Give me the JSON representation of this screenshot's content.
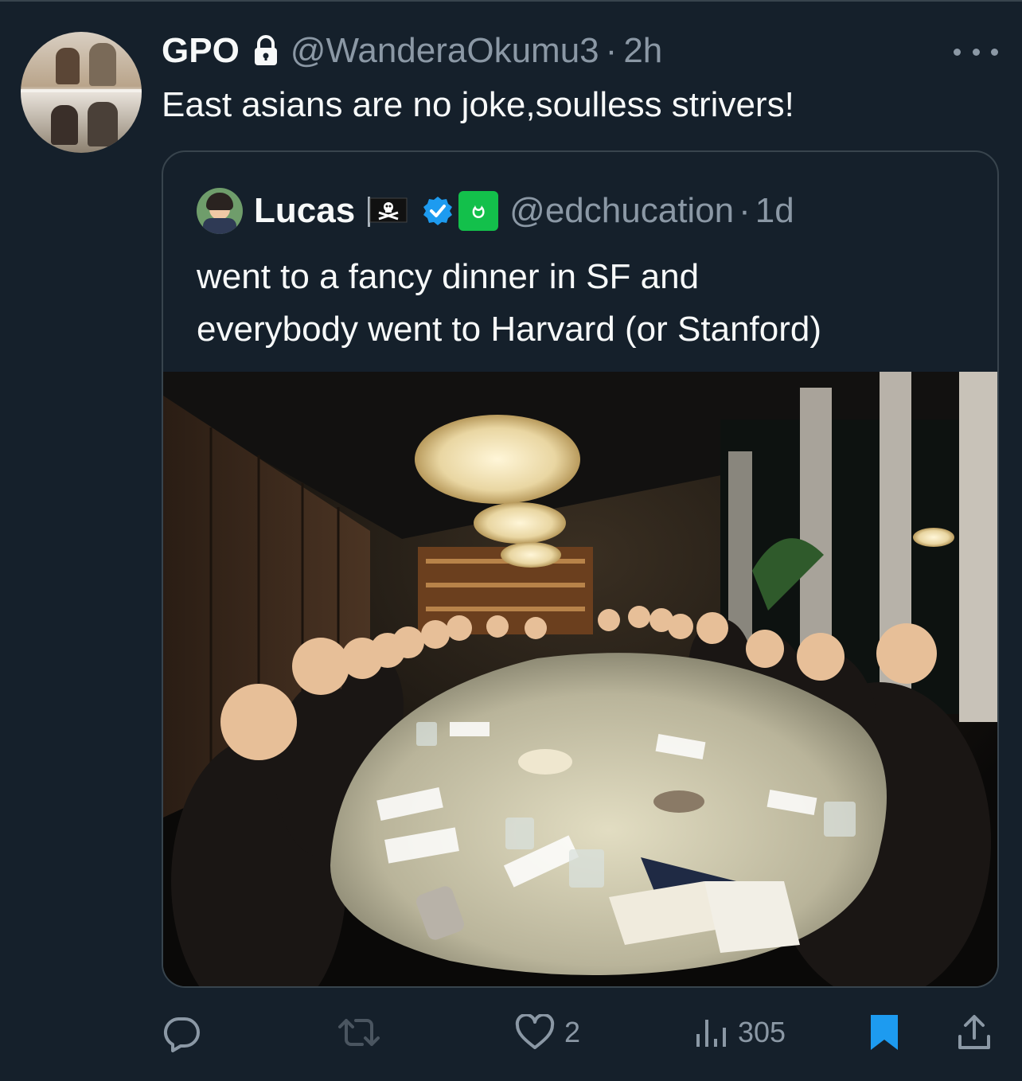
{
  "tweet": {
    "author_name": "GPO",
    "handle": "@WanderaOkumu3",
    "separator": "·",
    "time": "2h",
    "text": "East asians are no joke,soulless strivers!",
    "avatar_icon": "user-avatar-photo",
    "lock_icon": "lock-icon",
    "more_icon": "more-horizontal-icon"
  },
  "quoted": {
    "author_name": "Lucas",
    "handle": "@edchucation",
    "separator": "·",
    "time": "1d",
    "text_line1": "went to a fancy dinner in SF and",
    "text_line2": "everybody went to Harvard (or Stanford)",
    "flag_icon": "pirate-flag-icon",
    "verified_icon": "verified-badge-icon",
    "affiliate_badge_text": "ဗ",
    "affiliate_badge_color": "#13c04b",
    "verified_color": "#1d9bf0"
  },
  "actions": {
    "reply_icon": "reply-icon",
    "retweet_icon": "retweet-icon",
    "like_icon": "heart-icon",
    "like_count": "2",
    "views_icon": "views-icon",
    "views_count": "305",
    "bookmark_icon": "bookmark-icon",
    "bookmark_color": "#1d9bf0",
    "share_icon": "share-icon"
  },
  "colors": {
    "background": "#15202b",
    "primary_text": "#f7f9f9",
    "secondary_text": "#8b98a5",
    "border": "#38444d"
  }
}
